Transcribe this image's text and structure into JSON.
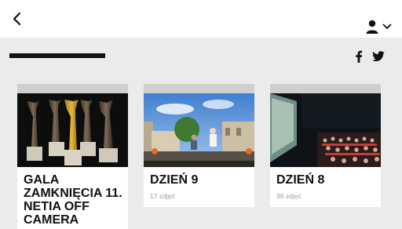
{
  "header": {
    "back_icon": "chevron-left-icon",
    "user_icon": "user-icon",
    "user_menu_icon": "chevron-down-icon"
  },
  "social": {
    "facebook_icon": "facebook-icon",
    "twitter_icon": "twitter-icon"
  },
  "galleries": [
    {
      "title": "GALA ZAMKNIĘCIA 11. NETIA OFF CAMERA",
      "count": ""
    },
    {
      "title": "DZIEŃ 9",
      "count": "17 zdjęć"
    },
    {
      "title": "DZIEŃ 8",
      "count": "39 zdjęć"
    }
  ]
}
